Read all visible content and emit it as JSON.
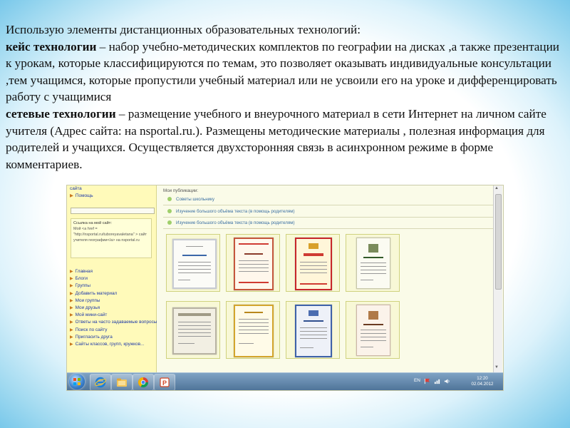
{
  "slide": {
    "intro": "Использую элементы дистанционных образовательных технологий:",
    "case_term": "кейс технологии",
    "case_text": " – набор учебно-методических комплектов по географии на дисках ,а также презентации к урокам, которые классифицируются по темам, это позволяет оказывать индивидуальные консультации ,тем учащимся, которые пропустили учебный материал или не усвоили его на уроке и дифференцировать работу с учащимися",
    "net_term": "сетевые технологии",
    "net_text": " – размещение учебного и внеурочного материал в сети Интернет на личном сайте учителя (Адрес сайта: на nsportal.ru.). Размещены методические материалы , полезная информация для родителей и учащихся. Осуществляется двухсторонняя связь в асинхронном режиме в форме комментариев."
  },
  "screenshot": {
    "sidebar": {
      "top_items": [
        "сайта",
        "Помощь"
      ],
      "link_box": {
        "title": "Ссылка на мой сайт:",
        "code_lines": [
          "Мой <a href =",
          "\"http://nsportal.ru/tuboreyavaletana\" > сайт",
          "учителя географии</a> на nsportal.ru"
        ]
      },
      "nav_items": [
        "Главная",
        "Блоги",
        "Группы",
        "Добавить материал",
        "Мои группы",
        "Мои друзья",
        "Мой мини-сайт",
        "Ответы на часто задаваемые вопросы",
        "Поиск по сайту",
        "Пригласить друга",
        "Сайты классов, групп, кружков..."
      ]
    },
    "content": {
      "pubs_title": "Мои публикации:",
      "pubs": [
        "Советы школьнику",
        "Изучение большого объёма текста (в помощь родителям)",
        "Изучение большого объёма текста (в помощь родителям)"
      ]
    },
    "taskbar": {
      "lang": "EN",
      "time": "12:20",
      "date": "02.04.2012"
    }
  },
  "icons": [
    "windows-start-icon",
    "internet-explorer-icon",
    "folder-icon",
    "chrome-icon",
    "powerpoint-icon",
    "flag-icon",
    "network-icon",
    "volume-icon"
  ],
  "colors": {
    "link_blue": "#1e3aa8",
    "sidebar_yellow": "#fffaba",
    "thumb_green": "#cfd27e",
    "taskbar_blue": "#4d7297"
  }
}
